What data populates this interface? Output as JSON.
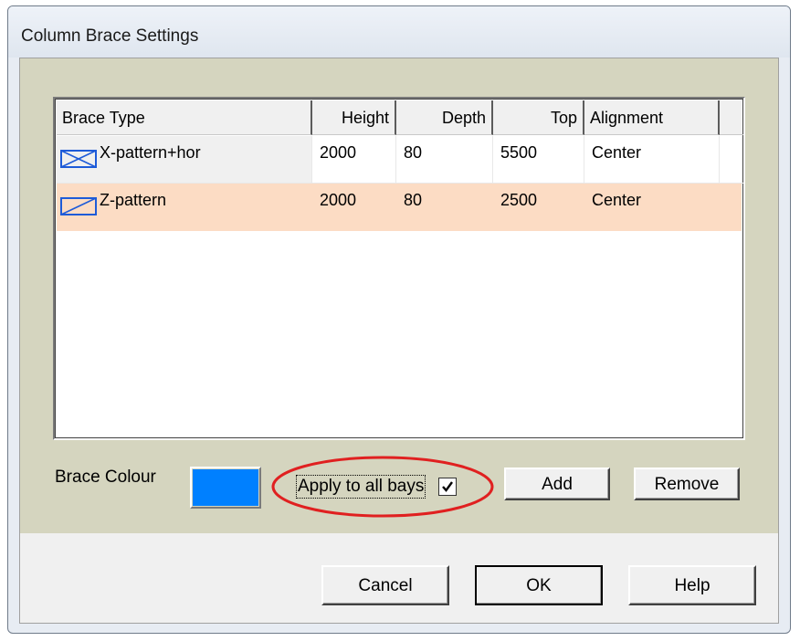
{
  "window": {
    "title": "Column Brace Settings"
  },
  "table": {
    "columns": [
      "Brace Type",
      "Height",
      "Depth",
      "Top",
      "Alignment"
    ],
    "rows": [
      {
        "icon": "x-pattern-brace-icon",
        "type": "X-pattern+hor",
        "height": "2000",
        "depth": "80",
        "top": "5500",
        "alignment": "Center"
      },
      {
        "icon": "z-pattern-brace-icon",
        "type": "Z-pattern",
        "height": "2000",
        "depth": "80",
        "top": "2500",
        "alignment": "Center"
      }
    ]
  },
  "brace_colour": {
    "label": "Brace Colour",
    "color": "#0080ff"
  },
  "apply_all": {
    "label": "Apply to all bays",
    "checked": true
  },
  "buttons": {
    "add": "Add",
    "remove": "Remove",
    "cancel": "Cancel",
    "ok": "OK",
    "help": "Help"
  },
  "colors": {
    "selected_row": "#fcdcc4",
    "panel": "#d5d5bf",
    "annotation": "#e02020",
    "brace_icon": "#1e5bd8"
  }
}
